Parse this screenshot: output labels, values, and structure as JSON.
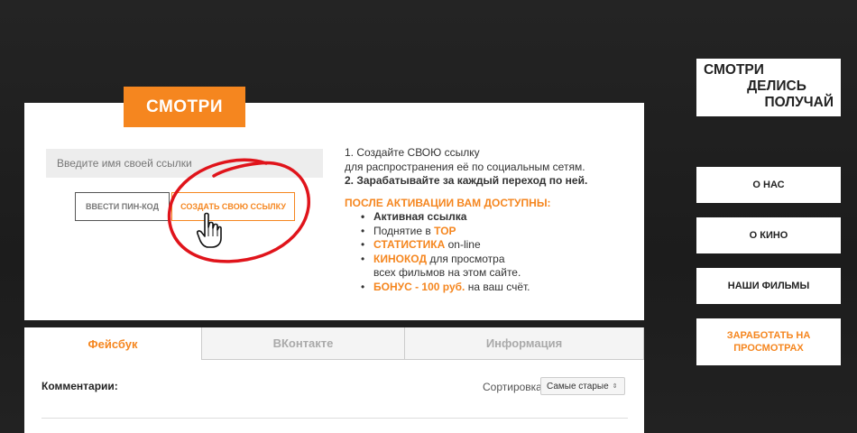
{
  "badge": "СМОТРИ",
  "form": {
    "name_placeholder": "Введите имя своей ссылки",
    "pin_button": "ВВЕСТИ ПИН-КОД",
    "create_button": "СОЗДАТЬ СВОЮ ССЫЛКУ"
  },
  "info": {
    "step1_a": "1. Создайте СВОЮ ссылку",
    "step1_b": "для распространения её по социальным сетям.",
    "step2": "2. Зарабатывайте за каждый переход по ней.",
    "heading": "ПОСЛЕ АКТИВАЦИИ ВАМ ДОСТУПНЫ:",
    "item1": "Активная ссылка",
    "item2_a": "Поднятие в ",
    "item2_b": "TOP",
    "item3_a": "СТАТИСТИКА",
    "item3_b": " on-line",
    "item4_a": "КИНОКОД",
    "item4_b": " для просмотра",
    "item4_c": "всех фильмов на этом сайте.",
    "item5_a": "БОНУС - 100 руб.",
    "item5_b": " на ваш счёт."
  },
  "tabs": {
    "facebook": "Фейсбук",
    "vk": "ВКонтакте",
    "info": "Информация"
  },
  "comments": {
    "label": "Комментарии:",
    "sort_label": "Сортировка",
    "sort_value": "Самые старые",
    "sort_arrows": "▲▼"
  },
  "sidebar": {
    "logo_1": "СМОТРИ",
    "logo_2": "ДЕЛИСЬ",
    "logo_3": "ПОЛУЧАЙ",
    "about": "О НАС",
    "cinema": "О КИНО",
    "films": "НАШИ ФИЛЬМЫ",
    "earn": "ЗАРАБОТАТЬ НА ПРОСМОТРАХ"
  },
  "colors": {
    "accent": "#f5861f",
    "background": "#1f1f1f",
    "annotation": "#e0141b"
  },
  "icons": {
    "cursor": "hand-pointer-icon",
    "annotation": "red-circle-annotation"
  }
}
